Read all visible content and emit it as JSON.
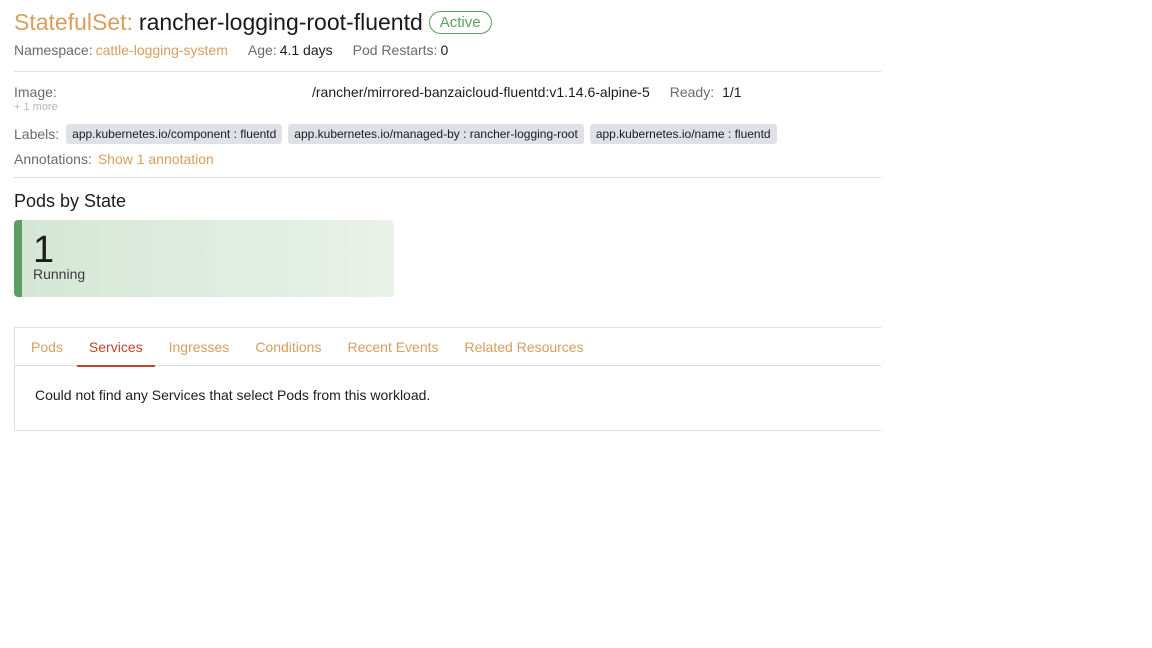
{
  "header": {
    "type_label": "StatefulSet:",
    "name": "rancher-logging-root-fluentd",
    "status": "Active"
  },
  "meta": {
    "namespace_label": "Namespace:",
    "namespace_value": "cattle-logging-system",
    "age_label": "Age:",
    "age_value": "4.1 days",
    "restarts_label": "Pod Restarts:",
    "restarts_value": "0"
  },
  "details": {
    "image_label": "Image:",
    "image_value": "/rancher/mirrored-banzaicloud-fluentd:v1.14.6-alpine-5",
    "ready_label": "Ready:",
    "ready_value": "1/1",
    "more_images": "+ 1 more",
    "labels_label": "Labels:",
    "labels": [
      "app.kubernetes.io/component : fluentd",
      "app.kubernetes.io/managed-by : rancher-logging-root",
      "app.kubernetes.io/name : fluentd"
    ],
    "annotations_label": "Annotations:",
    "annotations_link": "Show 1 annotation"
  },
  "pods_by_state": {
    "title": "Pods by State",
    "count": "1",
    "state": "Running"
  },
  "tabs": {
    "items": [
      {
        "label": "Pods"
      },
      {
        "label": "Services"
      },
      {
        "label": "Ingresses"
      },
      {
        "label": "Conditions"
      },
      {
        "label": "Recent Events"
      },
      {
        "label": "Related Resources"
      }
    ],
    "active": "Services",
    "body_text": "Could not find any Services that select Pods from this workload."
  },
  "colors": {
    "accent": "#d79e5e",
    "active_tab": "#c0462a",
    "success": "#5d9e62"
  }
}
